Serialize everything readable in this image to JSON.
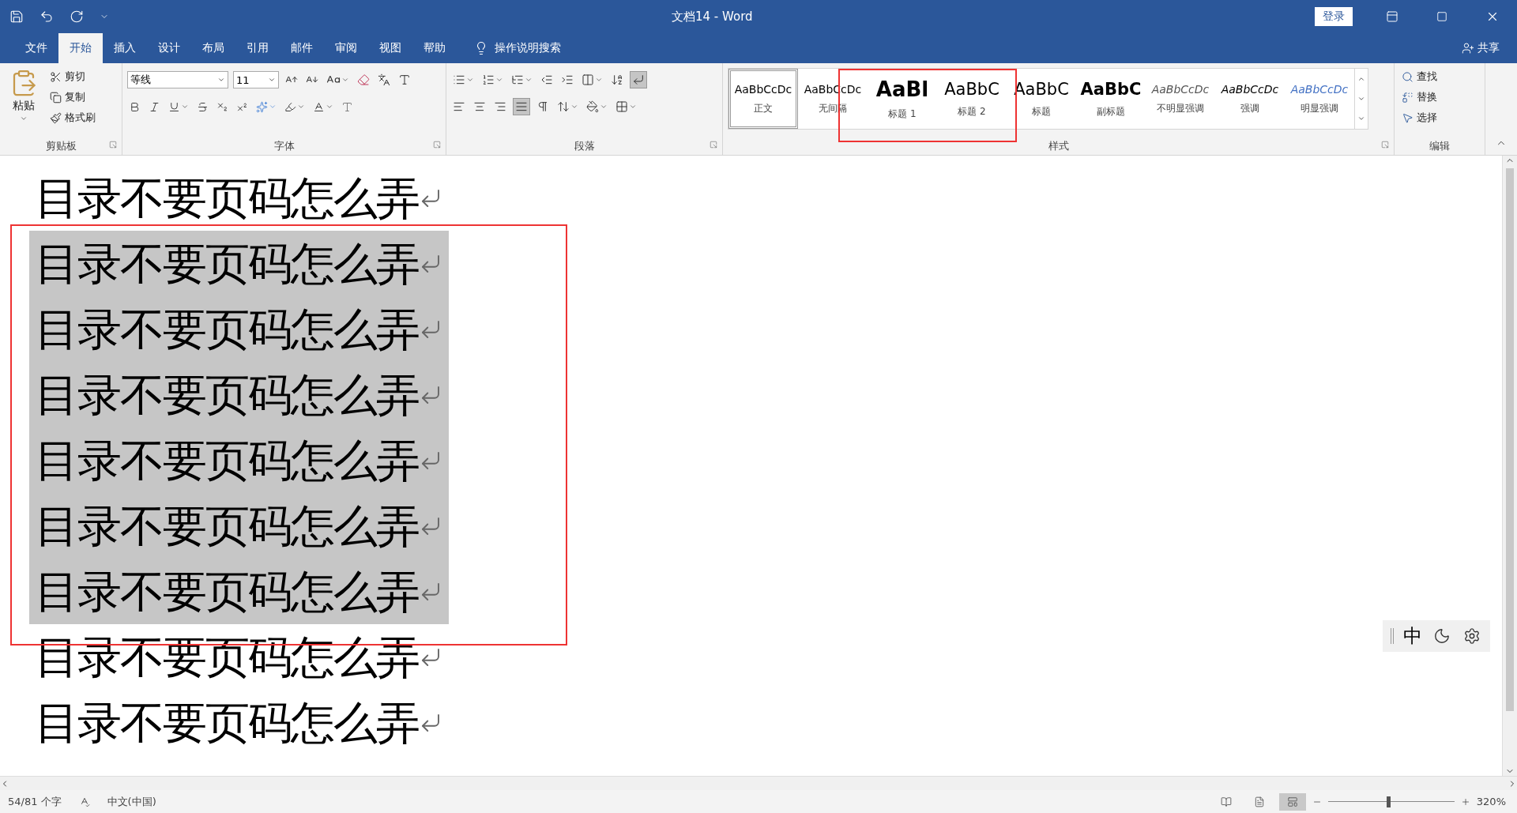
{
  "window": {
    "title": "文档14 - Word",
    "login": "登录"
  },
  "tabs": [
    {
      "label": "文件",
      "selected": false
    },
    {
      "label": "开始",
      "selected": true
    },
    {
      "label": "插入",
      "selected": false
    },
    {
      "label": "设计",
      "selected": false
    },
    {
      "label": "布局",
      "selected": false
    },
    {
      "label": "引用",
      "selected": false
    },
    {
      "label": "邮件",
      "selected": false
    },
    {
      "label": "审阅",
      "selected": false
    },
    {
      "label": "视图",
      "selected": false
    },
    {
      "label": "帮助",
      "selected": false
    }
  ],
  "tell_me": "操作说明搜索",
  "share": "共享",
  "clipboard": {
    "title": "剪贴板",
    "paste": "粘贴",
    "items": [
      "剪切",
      "复制",
      "格式刷"
    ]
  },
  "font": {
    "title": "字体",
    "font_name": "等线",
    "font_size": "11"
  },
  "paragraph": {
    "title": "段落"
  },
  "styles": {
    "title": "样式",
    "items": [
      {
        "kind": "normal",
        "preview": "AaBbCcDc",
        "label": "正文",
        "selected": true
      },
      {
        "kind": "no-spacing",
        "preview": "AaBbCcDc",
        "label": "无间隔",
        "selected": false
      },
      {
        "kind": "heading1",
        "preview": "AaBl",
        "label": "标题 1",
        "selected": false
      },
      {
        "kind": "heading2",
        "preview": "AaBbC",
        "label": "标题 2",
        "selected": false
      },
      {
        "kind": "title",
        "preview": "AaBbC",
        "label": "标题",
        "selected": false
      },
      {
        "kind": "subtitle",
        "preview": "AaBbC",
        "label": "副标题",
        "selected": false
      },
      {
        "kind": "subtle",
        "preview": "AaBbCcDc",
        "label": "不明显强调",
        "selected": false
      },
      {
        "kind": "emphasis",
        "preview": "AaBbCcDc",
        "label": "强调",
        "selected": false
      },
      {
        "kind": "intense",
        "preview": "AaBbCcDc",
        "label": "明显强调",
        "selected": false
      }
    ]
  },
  "editing": {
    "title": "编辑",
    "items": [
      "查找",
      "替换",
      "选择"
    ]
  },
  "document": {
    "lines": [
      {
        "text": "目录不要页码怎么弄",
        "selected": false
      },
      {
        "text": "目录不要页码怎么弄",
        "selected": true
      },
      {
        "text": "目录不要页码怎么弄",
        "selected": true
      },
      {
        "text": "目录不要页码怎么弄",
        "selected": true
      },
      {
        "text": "目录不要页码怎么弄",
        "selected": true
      },
      {
        "text": "目录不要页码怎么弄",
        "selected": true
      },
      {
        "text": "目录不要页码怎么弄",
        "selected": true
      },
      {
        "text": "目录不要页码怎么弄",
        "selected": false
      },
      {
        "text": "目录不要页码怎么弄",
        "selected": false
      }
    ]
  },
  "ime_bar": {
    "mode": "中"
  },
  "status_bar": {
    "word_count": "54/81 个字",
    "language": "中文(中国)",
    "zoom": {
      "level": 0.48,
      "reading": "320%"
    }
  }
}
